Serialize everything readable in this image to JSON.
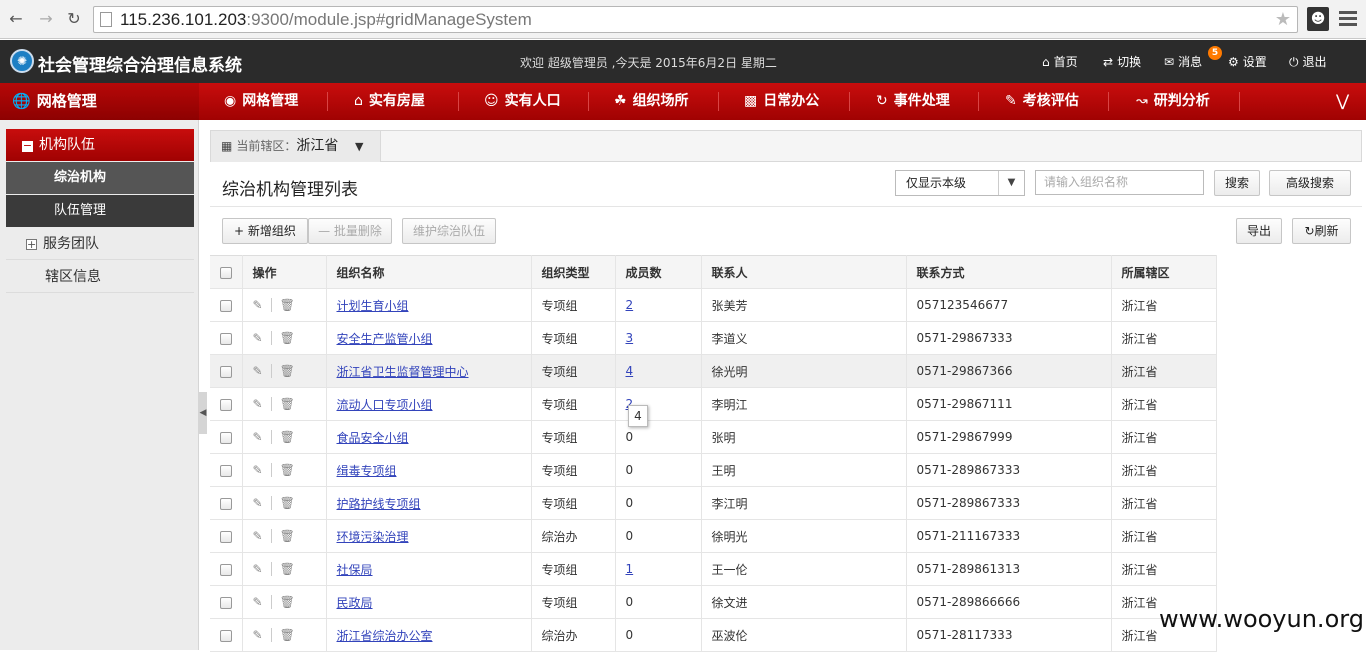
{
  "browser": {
    "url_host": "115.236.101.203",
    "url_rest": ":9300/module.jsp#gridManageSystem"
  },
  "header": {
    "title": "社会管理综合治理信息系统",
    "welcome": "欢迎  超级管理员 ,今天是  2015年6月2日 星期二",
    "links": {
      "home": "首页",
      "switch": "切换",
      "messages": "消息",
      "settings": "设置",
      "logout": "退出"
    },
    "message_count": "5"
  },
  "module_title": "网格管理",
  "topnav": [
    "网格管理",
    "实有房屋",
    "实有人口",
    "组织场所",
    "日常办公",
    "事件处理",
    "考核评估",
    "研判分析"
  ],
  "sidebar": {
    "group": "机构队伍",
    "subitems": [
      "综治机构",
      "队伍管理"
    ],
    "items": [
      "服务团队",
      "辖区信息"
    ]
  },
  "area": {
    "label": "当前辖区：",
    "value": "浙江省"
  },
  "list": {
    "title": "综治机构管理列表",
    "filter_value": "仅显示本级",
    "search_placeholder": "请输入组织名称",
    "search_button": "搜索",
    "advanced_button": "高级搜索",
    "add_button": "新增组织",
    "batch_delete_button": "批量删除",
    "maintain_button": "维护综治队伍",
    "export_button": "导出",
    "refresh_button": "刷新"
  },
  "table": {
    "columns": [
      "操作",
      "组织名称",
      "组织类型",
      "成员数",
      "联系人",
      "联系方式",
      "所属辖区"
    ],
    "rows": [
      {
        "name": "计划生育小组",
        "type": "专项组",
        "members": "2",
        "contact": "张美芳",
        "phone": "057123546677",
        "area": "浙江省"
      },
      {
        "name": "安全生产监管小组",
        "type": "专项组",
        "members": "3",
        "contact": "李道义",
        "phone": "0571-29867333",
        "area": "浙江省"
      },
      {
        "name": "浙江省卫生监督管理中心",
        "type": "专项组",
        "members": "4",
        "contact": "徐光明",
        "phone": "0571-29867366",
        "area": "浙江省"
      },
      {
        "name": "流动人口专项小组",
        "type": "专项组",
        "members": "2",
        "contact": "李明江",
        "phone": "0571-29867111",
        "area": "浙江省"
      },
      {
        "name": "食品安全小组",
        "type": "专项组",
        "members": "0",
        "contact": "张明",
        "phone": "0571-29867999",
        "area": "浙江省"
      },
      {
        "name": "缉毒专项组",
        "type": "专项组",
        "members": "0",
        "contact": "王明",
        "phone": "0571-289867333",
        "area": "浙江省"
      },
      {
        "name": "护路护线专项组",
        "type": "专项组",
        "members": "0",
        "contact": "李江明",
        "phone": "0571-289867333",
        "area": "浙江省"
      },
      {
        "name": "环境污染治理",
        "type": "综治办",
        "members": "0",
        "contact": "徐明光",
        "phone": "0571-211167333",
        "area": "浙江省"
      },
      {
        "name": "社保局",
        "type": "专项组",
        "members": "1",
        "contact": "王一伦",
        "phone": "0571-289861313",
        "area": "浙江省"
      },
      {
        "name": "民政局",
        "type": "专项组",
        "members": "0",
        "contact": "徐文进",
        "phone": "0571-289866666",
        "area": "浙江省"
      },
      {
        "name": "浙江省综治办公室",
        "type": "综治办",
        "members": "0",
        "contact": "巫波伦",
        "phone": "0571-28117333",
        "area": "浙江省"
      }
    ]
  },
  "tooltip": "4",
  "watermark": "www.wooyun.org"
}
